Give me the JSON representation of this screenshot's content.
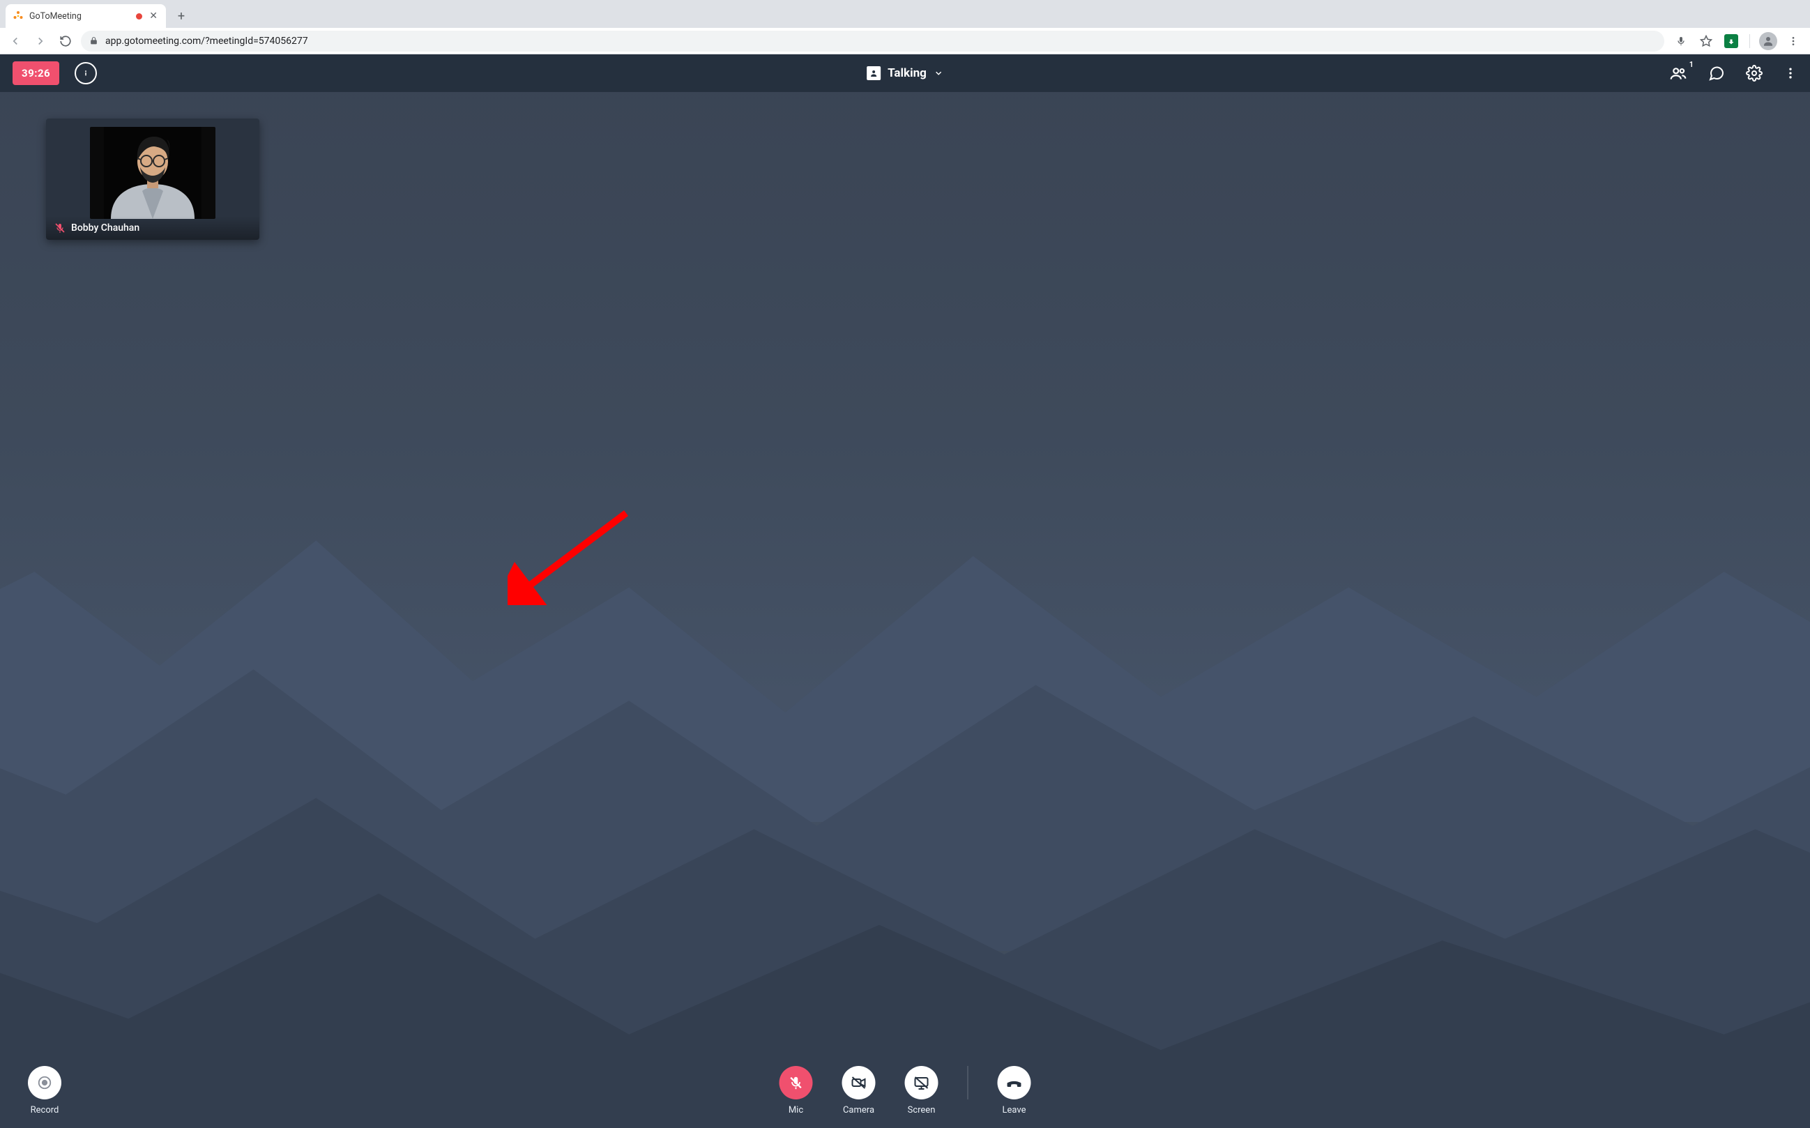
{
  "browser": {
    "tab_title": "GoToMeeting",
    "url": "app.gotomeeting.com/?meetingId=574056277"
  },
  "app_bar": {
    "timer": "39:26",
    "view_label": "Talking",
    "participants_badge": "1"
  },
  "participant": {
    "name": "Bobby Chauhan"
  },
  "controls": {
    "record": "Record",
    "mic": "Mic",
    "camera": "Camera",
    "screen": "Screen",
    "leave": "Leave"
  }
}
